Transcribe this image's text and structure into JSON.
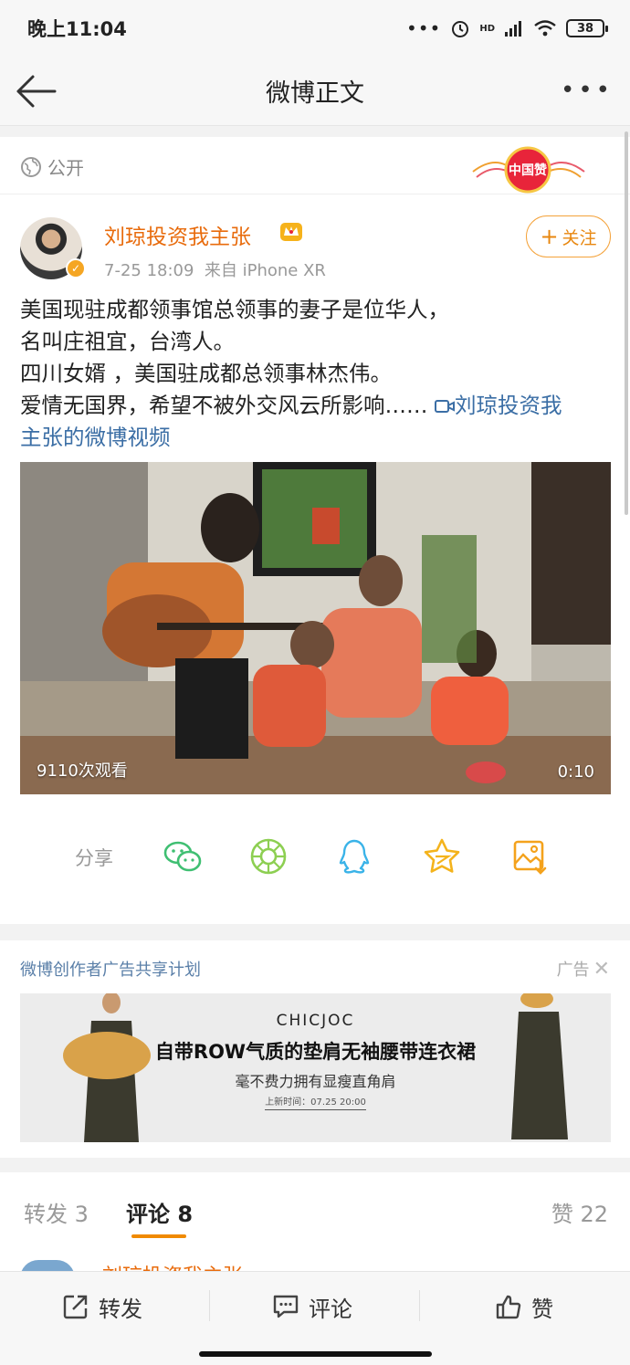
{
  "status_bar": {
    "time": "晚上11:04",
    "network": "HD",
    "battery": "38"
  },
  "nav": {
    "title": "微博正文"
  },
  "post": {
    "visibility": "公开",
    "badge_text": "中国赞",
    "author": "刘琼投资我主张",
    "meta": "7-25 18:09  来自 iPhone XR",
    "follow_label": "关注",
    "text_lines": [
      "美国现驻成都领事馆总领事的妻子是位华人，",
      "名叫庄祖宜，台湾人。",
      "四川女婿 ，美国驻成都总领事林杰伟。",
      "爱情无国界，希望不被外交风云所影响……"
    ],
    "link_part1": "刘琼投资我",
    "link_part2": "主张的微博视频",
    "video": {
      "views": "9110次观看",
      "duration": "0:10"
    },
    "share_label": "分享"
  },
  "ad": {
    "title": "微博创作者广告共享计划",
    "tag": "广告",
    "brand": "CHICJOC",
    "headline": "自带ROW气质的垫肩无袖腰带连衣裙",
    "sub": "毫不费力拥有显瘦直角肩",
    "date": "上新时间：07.25 20:00"
  },
  "tabs": {
    "repost": "转发 3",
    "comments": "评论 8",
    "likes": "赞 22",
    "peek_name": "刘琼投资我主张"
  },
  "bottom_bar": {
    "repost": "转发",
    "comment": "评论",
    "like": "赞"
  },
  "colors": {
    "accent_orange": "#e86b0c",
    "link_blue": "#3b6ea5",
    "tab_underline": "#f08a00"
  }
}
